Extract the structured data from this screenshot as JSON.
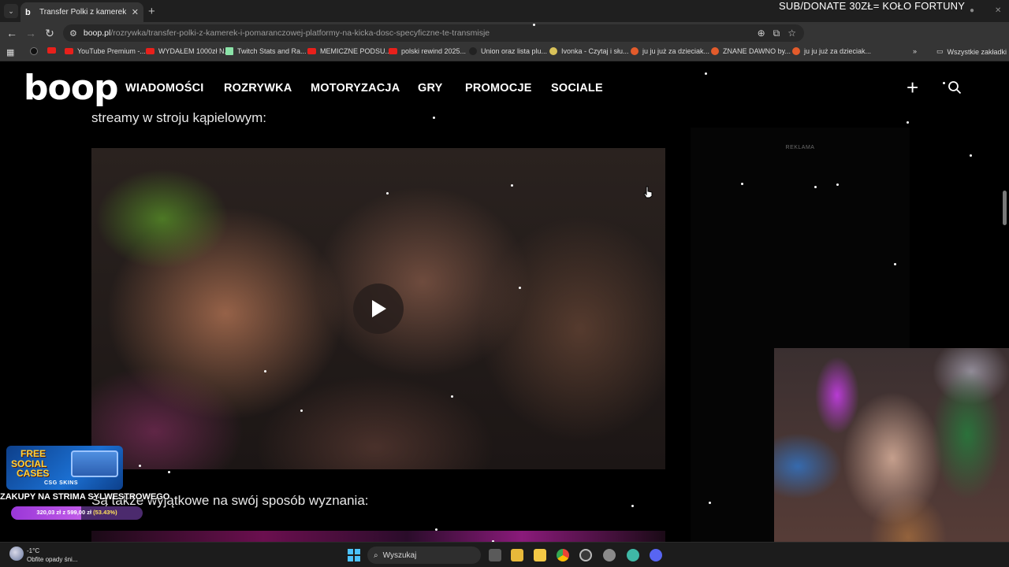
{
  "browser": {
    "tab_title": "Transfer Polki z kamerek i poma...",
    "tab_favicon": "b",
    "url_host": "boop.pl",
    "url_path": "/rozrywka/transfer-polki-z-kamerek-i-pomaranczowej-platformy-na-kicka-dosc-specyficzne-te-transmisje",
    "bookmarks": [
      {
        "label": "YouTube Premium -...",
        "icon": "youtube"
      },
      {
        "label": "WYDAŁEM 1000zł N...",
        "icon": "youtube"
      },
      {
        "label": "Twitch Stats and Ra...",
        "icon": "tt"
      },
      {
        "label": "MEMICZNE PODSU...",
        "icon": "youtube"
      },
      {
        "label": "polski rewind 2025...",
        "icon": "youtube"
      },
      {
        "label": "Union oraz lista plu...",
        "icon": "generic"
      },
      {
        "label": "Ivonka - Czytaj i słu...",
        "icon": "generic"
      },
      {
        "label": "ju ju już za dzieciak...",
        "icon": "generic"
      },
      {
        "label": "ZNANE DAWNO by...",
        "icon": "generic"
      },
      {
        "label": "ju ju już za dzieciak...",
        "icon": "generic"
      }
    ],
    "all_bookmarks": "Wszystkie zakładki"
  },
  "stream_overlay": {
    "top_text": "SUB/DONATE 30ZŁ= KOŁO FORTUNY",
    "promo_line1": "FREE",
    "promo_line2": "SOCIAL",
    "promo_line3": "CASES",
    "promo_brand": "CSG SKINS",
    "goal_title": "ZAKUPY NA STRIMA SYLWESTROWEGO",
    "goal_amount": "320,03 zł z 599,00 zł",
    "goal_percent": "(53.43%)",
    "goal_fraction": 0.5343
  },
  "site": {
    "logo": "boop",
    "nav": [
      "WIADOMOŚCI",
      "ROZRYWKA",
      "MOTORYZACJA",
      "GRY",
      "PROMOCJE",
      "SOCIALE"
    ],
    "article_text_top": "streamy w stroju kąpielowym:",
    "article_text_bottom": "Są także wyjątkowe na swój sposób wyznania:",
    "ad_label": "REKLAMA"
  },
  "taskbar": {
    "temperature": "-1°C",
    "weather": "Obfite opady śni...",
    "search_placeholder": "Wyszukaj"
  }
}
